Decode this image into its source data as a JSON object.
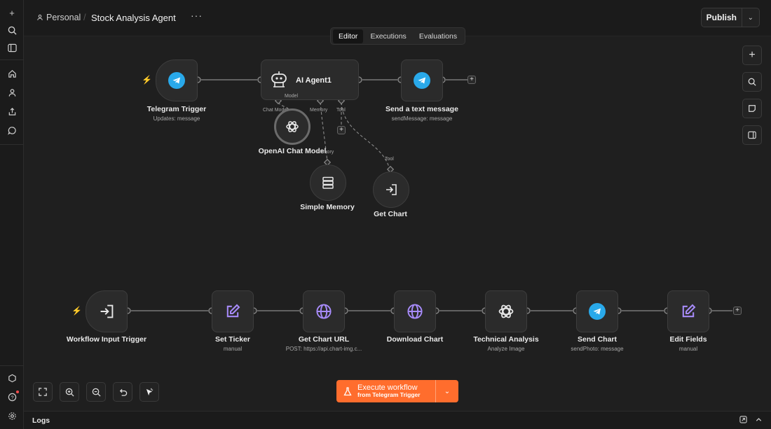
{
  "header": {
    "personal_label": "Personal",
    "workflow_title": "Stock Analysis Agent",
    "more_label": "···",
    "publish_label": "Publish"
  },
  "tabs": [
    {
      "label": "Editor",
      "active": true
    },
    {
      "label": "Executions",
      "active": false
    },
    {
      "label": "Evaluations",
      "active": false
    }
  ],
  "agent_flow": {
    "telegram_trigger": {
      "label": "Telegram Trigger",
      "sub": "Updates: message"
    },
    "ai_agent": {
      "label": "AI Agent1",
      "ports": [
        "Chat Model",
        "Memory",
        "Tool"
      ]
    },
    "send_text": {
      "label": "Send a text message",
      "sub": "sendMessage: message"
    },
    "chat_model": {
      "label": "OpenAI Chat Model",
      "port": "Model"
    },
    "memory": {
      "label": "Simple Memory",
      "port": "Memory"
    },
    "get_chart": {
      "label": "Get Chart",
      "port": "Tool"
    }
  },
  "main_flow": [
    {
      "label": "Workflow Input Trigger",
      "sub": "",
      "icon": "enter-icon"
    },
    {
      "label": "Set Ticker",
      "sub": "manual",
      "icon": "pencil-icon"
    },
    {
      "label": "Get Chart URL",
      "sub": "POST: https://api.chart-img.c...",
      "icon": "globe-icon"
    },
    {
      "label": "Download Chart",
      "sub": "",
      "icon": "globe-icon"
    },
    {
      "label": "Technical Analysis",
      "sub": "Analyze Image",
      "icon": "openai-icon"
    },
    {
      "label": "Send Chart",
      "sub": "sendPhoto: message",
      "icon": "telegram-icon"
    },
    {
      "label": "Edit Fields",
      "sub": "manual",
      "icon": "pencil-icon"
    }
  ],
  "execute": {
    "line1": "Execute workflow",
    "line2": "from Telegram Trigger"
  },
  "logs": {
    "label": "Logs"
  },
  "colors": {
    "accent": "#ff6d2d",
    "telegram": "#29a9ea",
    "node_icon_purple": "#a78bfa",
    "canvas": "#1f1f1f"
  }
}
